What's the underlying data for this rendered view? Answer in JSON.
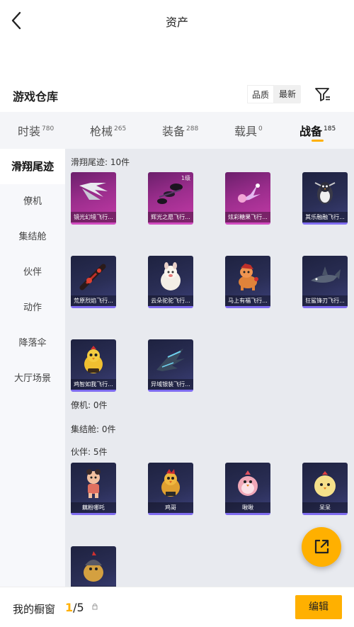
{
  "header": {
    "title": "资产",
    "back_icon": "chevron-left-icon"
  },
  "warehouse": {
    "title": "游戏仓库",
    "sort_options": [
      "品质",
      "最新"
    ],
    "filter_icon": "filter-icon"
  },
  "tabs": [
    {
      "label": "时装",
      "count": "780"
    },
    {
      "label": "枪械",
      "count": "265"
    },
    {
      "label": "装备",
      "count": "288"
    },
    {
      "label": "载具",
      "count": "0"
    },
    {
      "label": "战备",
      "count": "185",
      "active": true
    }
  ],
  "sidebar": {
    "items": [
      "滑翔尾迹",
      "僚机",
      "集结舱",
      "伙伴",
      "动作",
      "降落伞",
      "大厅场景"
    ],
    "active": "滑翔尾迹"
  },
  "groups": {
    "trail": {
      "label": "滑翔尾迹: 10件",
      "items": [
        {
          "name": "镜光幻境飞行...",
          "rarity": "purple",
          "icon": "wing-trail-icon"
        },
        {
          "name": "辉光之愿飞行...",
          "rarity": "purple",
          "icon": "dark-trail-icon",
          "badge": "1级"
        },
        {
          "name": "炫彩糖果飞行...",
          "rarity": "purple",
          "icon": "candy-trail-icon"
        },
        {
          "name": "其乐融融飞行...",
          "rarity": "dark",
          "icon": "penguin-icon"
        },
        {
          "name": "荒原烈焰飞行...",
          "rarity": "dark",
          "icon": "flame-trail-icon"
        },
        {
          "name": "云朵驼驼飞行...",
          "rarity": "dark",
          "icon": "alpaca-icon"
        },
        {
          "name": "马上有福飞行...",
          "rarity": "dark",
          "icon": "horse-icon"
        },
        {
          "name": "狂鲨锋刃飞行...",
          "rarity": "dark",
          "icon": "shark-icon"
        },
        {
          "name": "鸡智如我飞行...",
          "rarity": "dark",
          "icon": "chicken-icon"
        },
        {
          "name": "异域银装飞行...",
          "rarity": "dark",
          "icon": "mecha-wing-icon"
        }
      ]
    },
    "drone": {
      "label": "僚机: 0件"
    },
    "pod": {
      "label": "集结舱: 0件"
    },
    "partner": {
      "label": "伙伴: 5件",
      "items": [
        {
          "name": "藕粉哪吒",
          "rarity": "dark",
          "icon": "nezha-icon"
        },
        {
          "name": "鸡哥",
          "rarity": "dark",
          "icon": "rooster-icon"
        },
        {
          "name": "啾啾",
          "rarity": "dark",
          "icon": "pink-bird-icon"
        },
        {
          "name": "呆呆",
          "rarity": "dark",
          "icon": "chick-icon"
        },
        {
          "name": "",
          "rarity": "dark",
          "icon": "knight-chicken-icon"
        }
      ]
    }
  },
  "share_icon": "share-out-icon",
  "bottom_bar": {
    "label": "我的橱窗",
    "current": "1",
    "total": "/5",
    "lock_icon": "lock-icon",
    "edit_label": "编辑"
  },
  "colors": {
    "accent": "#ffb000",
    "purple_card": "#9a2d8c",
    "dark_card": "#2a2e55"
  }
}
